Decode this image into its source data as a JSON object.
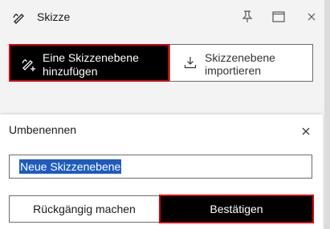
{
  "titlebar": {
    "title": "Skizze",
    "icons": {
      "app": "sketch-pen-icon",
      "pin": "pin-icon",
      "maximize": "maximize-icon",
      "close": "close-icon"
    }
  },
  "actions": {
    "add_layer_label": "Eine Skizzenebene hinzufügen",
    "import_layer_label": "Skizzenebene importieren",
    "add_icon": "sketch-add-icon",
    "import_icon": "download-icon"
  },
  "rename_dialog": {
    "title": "Umbenennen",
    "input_value": "Neue Skizzenebene",
    "undo_label": "Rückgängig machen",
    "confirm_label": "Bestätigen"
  },
  "colors": {
    "highlight_border": "#d8000c",
    "primary_button_bg": "#000000",
    "selection_bg": "#1e5bbf"
  }
}
